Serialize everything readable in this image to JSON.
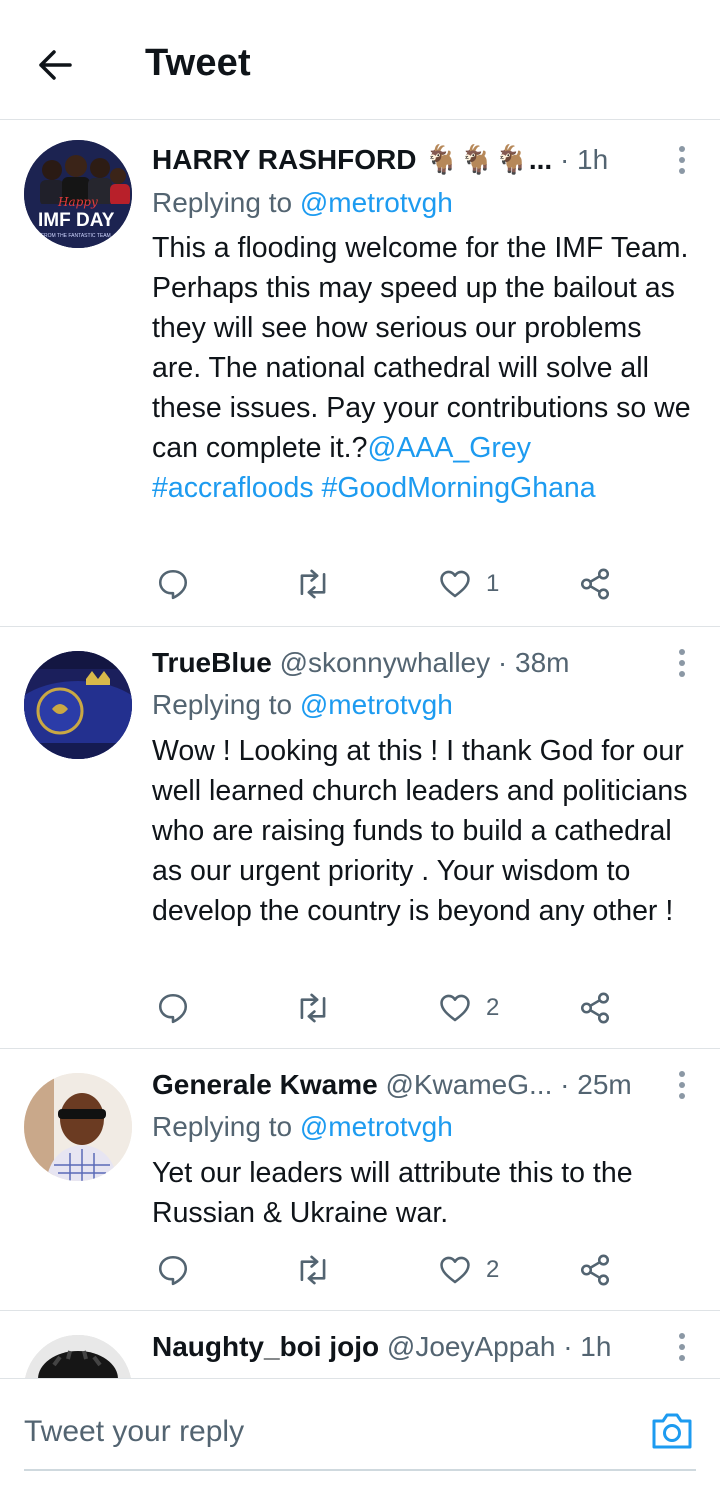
{
  "header": {
    "title": "Tweet",
    "back_icon": "arrow-left-icon"
  },
  "accent_color": "#1d9bf0",
  "tweets": [
    {
      "name": "HARRY RASHFORD 🐐🐐🐐...",
      "handle": "",
      "time": " · 1h",
      "replying_prefix": "Replying to ",
      "replying_to": "@metrotvgh",
      "text": "This a flooding welcome for the IMF Team. Perhaps this may speed up the bailout as they will see how serious our problems are. The national cathedral will solve all these issues. Pay your contributions so we can complete it.?",
      "links": [
        "@AAA_Grey",
        "#accrafloods",
        "#GoodMorningGhana"
      ],
      "avatar_text_top": "Happy",
      "avatar_text_main": "IMF DAY",
      "avatar_text_sub": "FROM THE FANTASTIC TEAM",
      "like_count": "1"
    },
    {
      "name": "TrueBlue",
      "handle": " @skonnywhalley",
      "time": " · 38m",
      "replying_prefix": "Replying to ",
      "replying_to": "@metrotvgh",
      "text": "Wow ! Looking at this ! I thank God for our well learned church leaders and politicians who are raising funds to build a cathedral as our urgent priority . Your wisdom to develop the country is beyond  any other !",
      "like_count": "2"
    },
    {
      "name": "Generale Kwame",
      "handle": " @KwameG...",
      "time": " · 25m",
      "replying_prefix": "Replying to ",
      "replying_to": "@metrotvgh",
      "text": "Yet our leaders will attribute this to the Russian & Ukraine war.",
      "like_count": "2"
    },
    {
      "name": "Naughty_boi jojo",
      "handle": " @JoeyAppah",
      "time": " · 1h"
    }
  ],
  "composer": {
    "placeholder": "Tweet your reply",
    "camera_icon": "camera-icon"
  }
}
